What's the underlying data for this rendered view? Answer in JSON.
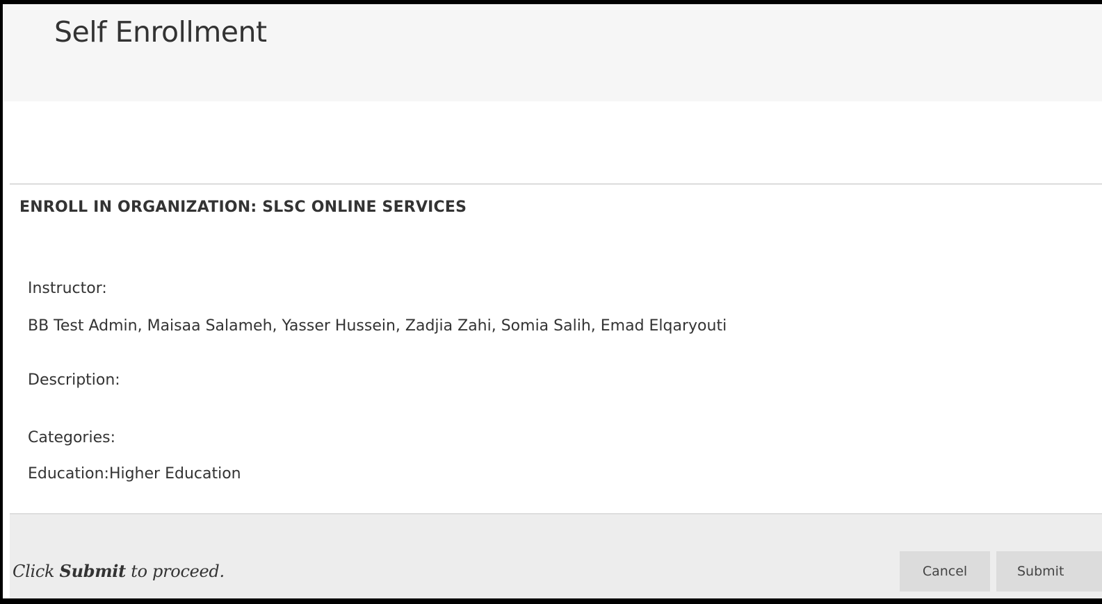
{
  "header": {
    "title": "Self Enrollment"
  },
  "section": {
    "heading": "ENROLL IN ORGANIZATION: SLSC ONLINE SERVICES"
  },
  "details": {
    "instructor_label": "Instructor:",
    "instructor_value": "BB Test Admin, Maisaa Salameh, Yasser Hussein, Zadjia Zahi, Somia Salih, Emad Elqaryouti",
    "description_label": "Description:",
    "categories_label": "Categories:",
    "categories_value": "Education:Higher Education"
  },
  "footer": {
    "hint_prefix": "Click ",
    "hint_emphasis": "Submit",
    "hint_suffix": " to proceed.",
    "cancel_label": "Cancel",
    "submit_label": "Submit"
  },
  "colors": {
    "header_background": "#f6f6f6",
    "footer_background": "#ededed",
    "button_background": "#dcdcdc",
    "text": "#333333"
  }
}
